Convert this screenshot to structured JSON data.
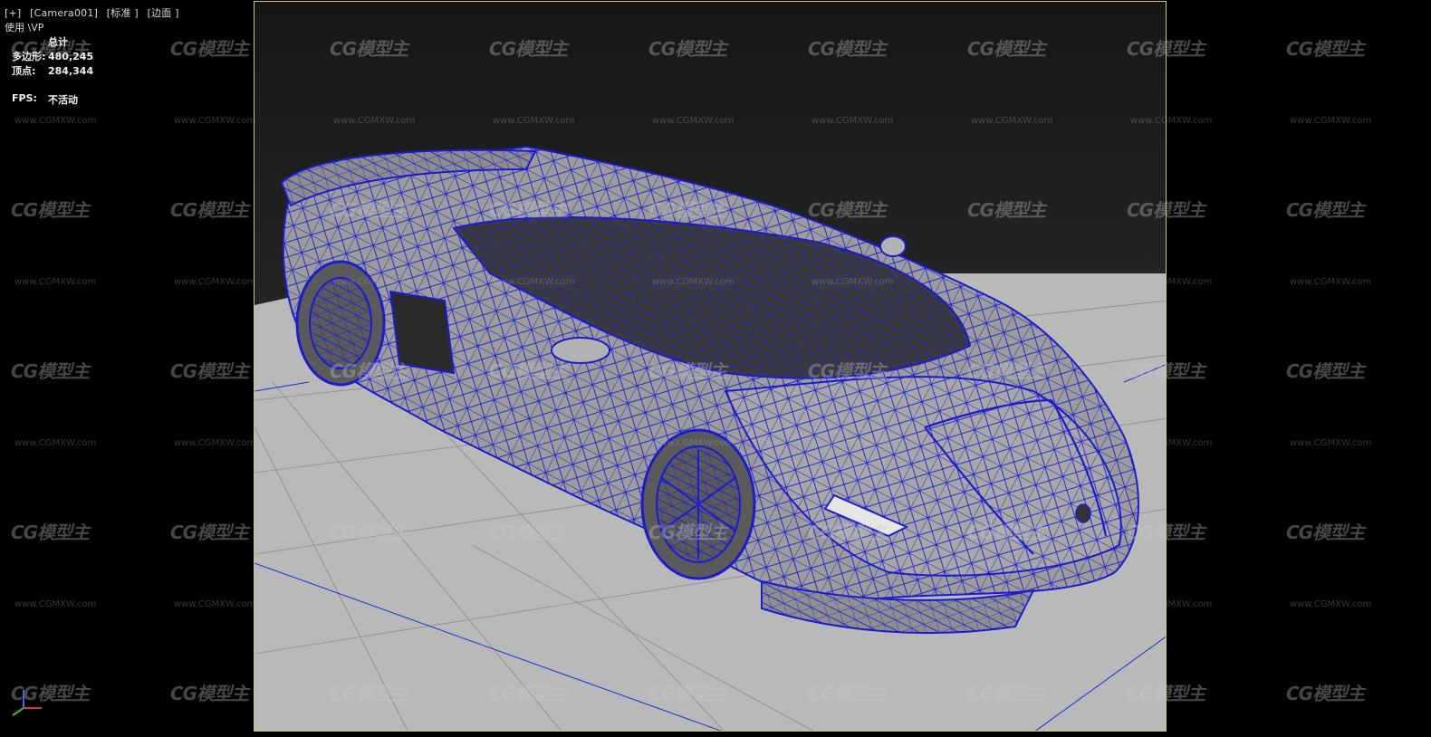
{
  "viewport": {
    "labels": [
      "[+]",
      "[Camera001]",
      "[标准 ]",
      "[边面 ]"
    ],
    "nitrous_label": "使用 \\VP",
    "stats": {
      "header": "总计",
      "polys_label": "多边形:",
      "polys_value": "480,245",
      "verts_label": "顶点:",
      "verts_value": "284,344"
    },
    "fps": {
      "label": "FPS:",
      "value": "不活动"
    }
  },
  "watermark": {
    "logo_text": "CG模型主",
    "url_text": "www.CGMXW.com"
  },
  "colors": {
    "background": "#000000",
    "render_bg_top": "#1f1f1f",
    "floor": "#b9b9b9",
    "wire": "#1c1ccf",
    "safe_frame": "#cfc75a"
  }
}
